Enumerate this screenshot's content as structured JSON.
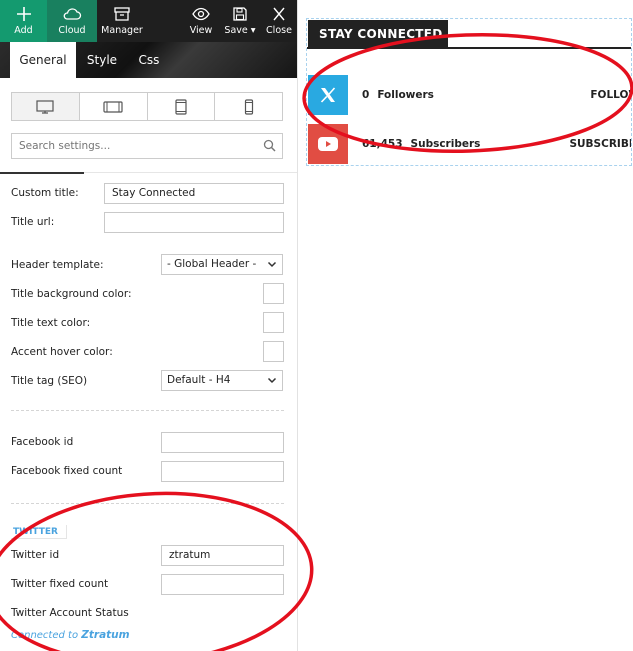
{
  "toolbar": {
    "add_label": "Add",
    "cloud_label": "Cloud",
    "manager_label": "Manager",
    "view_label": "View",
    "save_label": "Save",
    "close_label": "Close"
  },
  "tabs": {
    "general": "General",
    "style": "Style",
    "css": "Css"
  },
  "search": {
    "placeholder": "Search settings..."
  },
  "form": {
    "custom_title_label": "Custom title:",
    "custom_title_value": "Stay Connected",
    "title_url_label": "Title url:",
    "title_url_value": "",
    "header_template_label": "Header template:",
    "header_template_value": "- Global Header -",
    "title_bg_color_label": "Title background color:",
    "title_text_color_label": "Title text color:",
    "accent_hover_color_label": "Accent hover color:",
    "title_tag_label": "Title tag (SEO)",
    "title_tag_value": "Default - H4",
    "facebook_id_label": "Facebook id",
    "facebook_id_value": "",
    "facebook_fixed_count_label": "Facebook fixed count",
    "facebook_fixed_count_value": "",
    "twitter_section": "TWITTER",
    "twitter_id_label": "Twitter id",
    "twitter_id_value": "ztratum",
    "twitter_fixed_count_label": "Twitter fixed count",
    "twitter_fixed_count_value": "",
    "twitter_status_label": "Twitter Account Status",
    "twitter_connected_prefix": "Connected to",
    "twitter_connected_account": "Ztratum"
  },
  "preview": {
    "title": "STAY CONNECTED",
    "rows": [
      {
        "network": "x",
        "count": "0",
        "unit": "Followers",
        "action": "FOLLOW",
        "icon": "x-logo-icon",
        "color": "#29a9e1"
      },
      {
        "network": "youtube",
        "count": "61,453",
        "unit": "Subscribers",
        "action": "SUBSCRIBE",
        "icon": "youtube-logo-icon",
        "color": "#e14d43"
      }
    ]
  },
  "colors": {
    "add_green": "#149a6f",
    "cloud_green": "#19805f",
    "toolbar_dark": "#1f1f1f",
    "annotation_red": "#e4101e",
    "link_blue": "#4aa3df"
  }
}
